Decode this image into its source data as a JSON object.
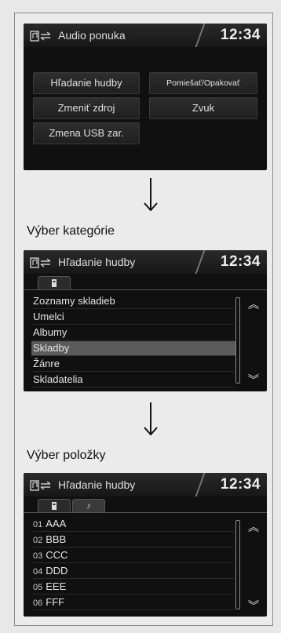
{
  "screen1": {
    "title": "Audio ponuka",
    "clock": "12:34",
    "buttons": {
      "search_music": "Hľadanie hudby",
      "shuffle_repeat": "Pomiešať/Opakovať",
      "change_source": "Zmeniť zdroj",
      "sound": "Zvuk",
      "change_usb": "Zmena USB zar."
    }
  },
  "captions": {
    "select_category": "Výber kategórie",
    "select_item": "Výber položky"
  },
  "screen2": {
    "title": "Hľadanie hudby",
    "clock": "12:34",
    "items": [
      "Zoznamy skladieb",
      "Umelci",
      "Albumy",
      "Skladby",
      "Žánre",
      "Skladatelia"
    ],
    "selected_index": 3
  },
  "screen3": {
    "title": "Hľadanie hudby",
    "clock": "12:34",
    "tab2_glyph": "♪",
    "items": [
      {
        "num": "01",
        "label": "AAA"
      },
      {
        "num": "02",
        "label": "BBB"
      },
      {
        "num": "03",
        "label": "CCC"
      },
      {
        "num": "04",
        "label": "DDD"
      },
      {
        "num": "05",
        "label": "EEE"
      },
      {
        "num": "06",
        "label": "FFF"
      }
    ]
  },
  "icons": {
    "audio": "audio-source-icon",
    "device_tab": "usb-device-icon",
    "scroll_up": "double-chevron-up-icon",
    "scroll_down": "double-chevron-down-icon",
    "flow_arrow": "arrow-down-icon"
  }
}
